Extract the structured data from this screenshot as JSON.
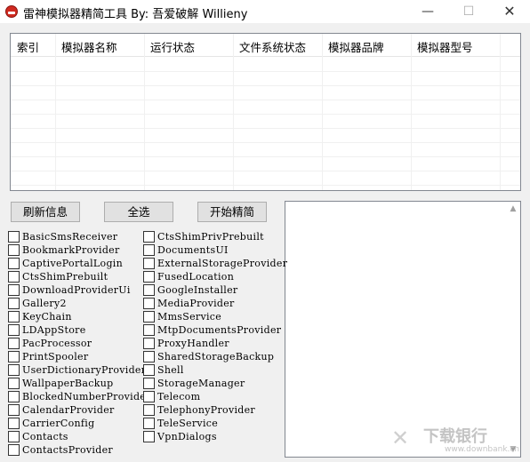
{
  "window": {
    "title": "雷神模拟器精简工具 By:  吾爱破解 Willieny",
    "min_glyph": "—",
    "max_glyph": "☐",
    "close_glyph": "✕"
  },
  "table": {
    "columns": [
      "索引",
      "模拟器名称",
      "运行状态",
      "文件系统状态",
      "模拟器品牌",
      "模拟器型号"
    ]
  },
  "buttons": {
    "refresh": "刷新信息",
    "select_all": "全选",
    "start": "开始精简"
  },
  "packages_left": [
    "BasicSmsReceiver",
    "BookmarkProvider",
    "CaptivePortalLogin",
    "CtsShimPrebuilt",
    "DownloadProviderUi",
    "Gallery2",
    "KeyChain",
    "LDAppStore",
    "PacProcessor",
    "PrintSpooler",
    "UserDictionaryProvider",
    "WallpaperBackup",
    "BlockedNumberProvider",
    "CalendarProvider",
    "CarrierConfig",
    "Contacts",
    "ContactsProvider"
  ],
  "packages_right": [
    "CtsShimPrivPrebuilt",
    "DocumentsUI",
    "ExternalStorageProvider",
    "FusedLocation",
    "GoogleInstaller",
    "MediaProvider",
    "MmsService",
    "MtpDocumentsProvider",
    "ProxyHandler",
    "SharedStorageBackup",
    "Shell",
    "StorageManager",
    "Telecom",
    "TelephonyProvider",
    "TeleService",
    "VpnDialogs"
  ],
  "watermark": {
    "title": "下载银行",
    "sub": "www.downbank.cn",
    "mark": "✕"
  },
  "icons": {
    "app": "thunder-emulator-icon",
    "scroll_up": "▲",
    "scroll_down": "▼"
  }
}
